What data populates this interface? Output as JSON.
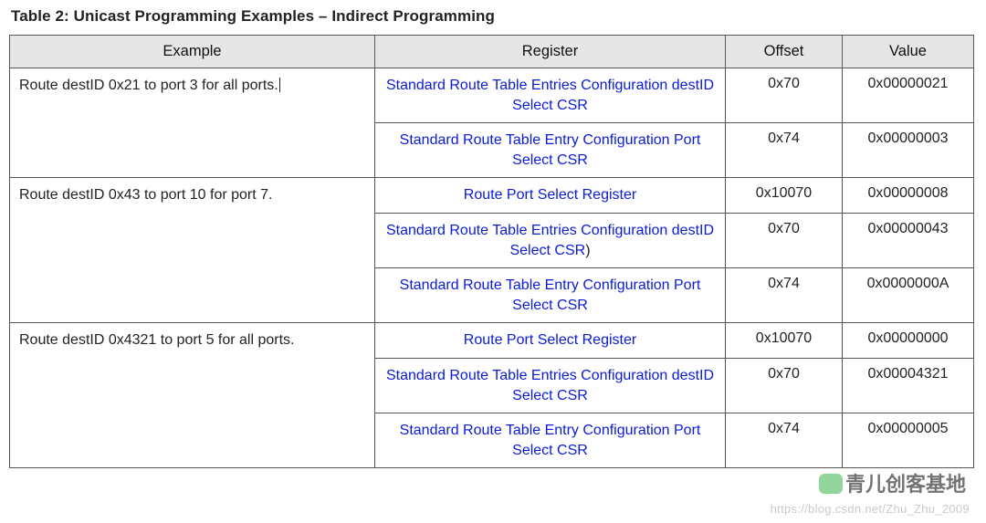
{
  "table_title": "Table 2: Unicast Programming Examples – Indirect Programming",
  "headers": {
    "example": "Example",
    "register": "Register",
    "offset": "Offset",
    "value": "Value"
  },
  "groups": [
    {
      "example": "Route destID 0x21 to port 3 for all ports.",
      "rows": [
        {
          "register": "Standard Route Table Entries Configuration destID Select CSR",
          "paren": false,
          "offset": "0x70",
          "value": "0x00000021"
        },
        {
          "register": "Standard Route Table Entry Configuration Port Select CSR",
          "paren": false,
          "offset": "0x74",
          "value": "0x00000003"
        }
      ]
    },
    {
      "example": "Route destID 0x43 to port 10 for port 7.",
      "rows": [
        {
          "register": "Route Port Select Register",
          "paren": false,
          "offset": "0x10070",
          "value": "0x00000008"
        },
        {
          "register": "Standard Route Table Entries Configuration destID Select CSR",
          "paren": true,
          "offset": "0x70",
          "value": "0x00000043"
        },
        {
          "register": "Standard Route Table Entry Configuration Port Select CSR",
          "paren": false,
          "offset": "0x74",
          "value": "0x0000000A"
        }
      ]
    },
    {
      "example": "Route destID 0x4321 to port 5 for all ports.",
      "rows": [
        {
          "register": "Route Port Select Register",
          "paren": false,
          "offset": "0x10070",
          "value": "0x00000000"
        },
        {
          "register": "Standard Route Table Entries Configuration destID Select CSR",
          "paren": false,
          "offset": "0x70",
          "value": "0x00004321"
        },
        {
          "register": "Standard Route Table Entry Configuration Port Select CSR",
          "paren": false,
          "offset": "0x74",
          "value": "0x00000005"
        }
      ]
    }
  ],
  "watermark": {
    "text1": "青儿创客基地",
    "text2": "https://blog.csdn.net/Zhu_Zhu_2009"
  }
}
